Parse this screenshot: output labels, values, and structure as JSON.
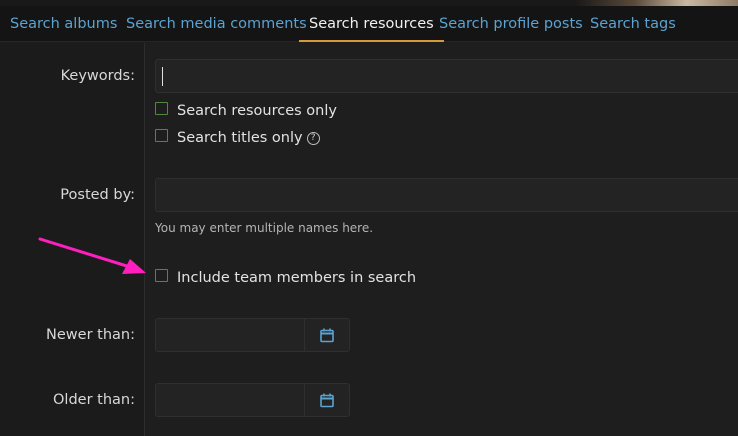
{
  "tabs": [
    {
      "label": "Search albums"
    },
    {
      "label": "Search media comments"
    },
    {
      "label": "Search resources",
      "active": true
    },
    {
      "label": "Search profile posts"
    },
    {
      "label": "Search tags"
    }
  ],
  "form": {
    "keywords_label": "Keywords:",
    "keywords_value": "",
    "search_resources_only": "Search resources only",
    "search_titles_only": "Search titles only",
    "help_glyph": "?",
    "posted_by_label": "Posted by:",
    "posted_by_value": "",
    "posted_by_hint": "You may enter multiple names here.",
    "include_team": "Include team members in search",
    "newer_than_label": "Newer than:",
    "older_than_label": "Older than:"
  },
  "colors": {
    "link": "#5ba3d0",
    "active_tab_underline": "#d79a3a",
    "checkbox_border": "#4f8a3c",
    "calendar_icon": "#5ba3d0",
    "annotation_arrow": "#ff1fbf"
  },
  "icons": {
    "calendar": "calendar-icon",
    "help": "help-icon",
    "annotation": "pink-arrow-annotation"
  }
}
